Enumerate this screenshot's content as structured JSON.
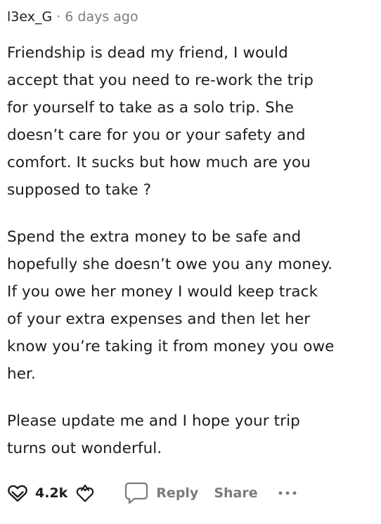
{
  "comment": {
    "author": "l3ex_G",
    "separator": "·",
    "timestamp": "6 days ago",
    "paragraphs": [
      [
        "Friendship is dead my friend, I would",
        "accept that you need to re-work the trip",
        "for yourself to take as a solo trip. She",
        "doesn’t care for you or your safety and",
        "comfort. It sucks but how much are you",
        "supposed to take ?"
      ],
      [
        "Spend the extra money to be safe and",
        "hopefully she doesn’t owe you any money.",
        "If you owe her money I would keep track",
        "of your extra expenses and then let her",
        "know you’re taking it from money you owe",
        "her."
      ],
      [
        "Please update me and I hope your trip",
        "turns out wonderful."
      ]
    ]
  },
  "actions": {
    "upvote_icon": "upvote-icon",
    "score": "4.2k",
    "downvote_icon": "downvote-icon",
    "reply_icon": "reply-bubble-icon",
    "reply_label": "Reply",
    "share_label": "Share",
    "more_icon": "more-dots-icon"
  },
  "colors": {
    "text": "#1c1c1c",
    "muted": "#7c7c7c",
    "background": "#ffffff"
  }
}
